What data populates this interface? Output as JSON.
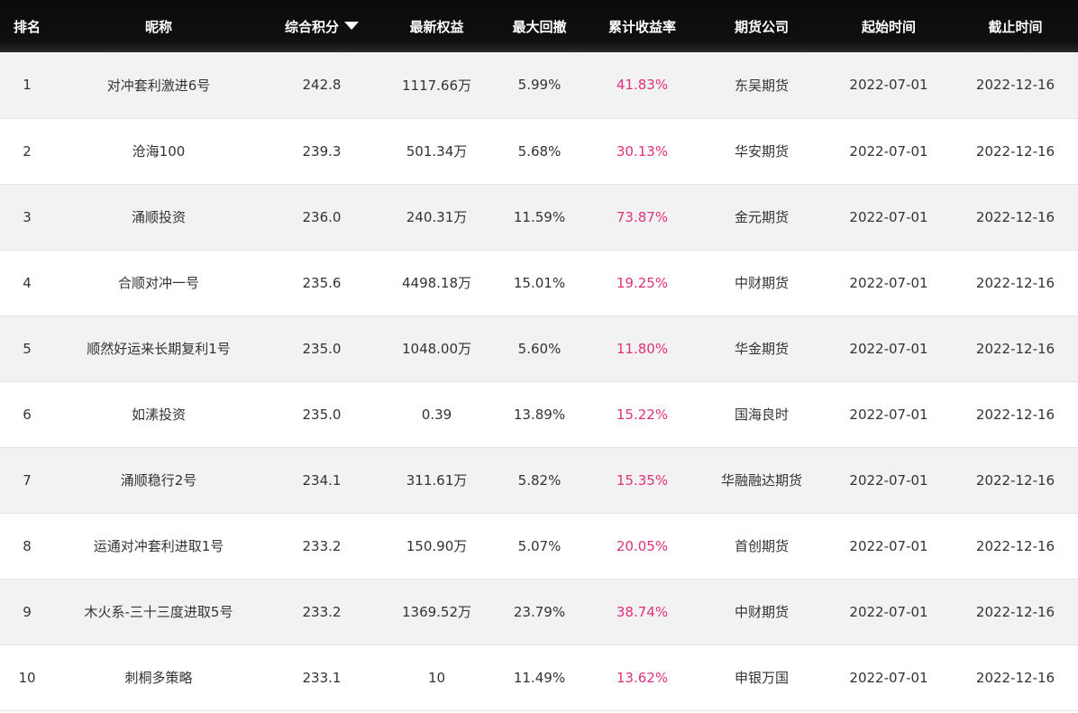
{
  "table": {
    "headers": {
      "rank": "排名",
      "nickname": "昵称",
      "score": "综合积分",
      "equity": "最新权益",
      "drawdown": "最大回撤",
      "return": "累计收益率",
      "company": "期货公司",
      "start": "起始时间",
      "end": "截止时间"
    },
    "sort": {
      "column": "score",
      "direction": "descending",
      "icon": "sort-desc-triangle-icon"
    },
    "rows": [
      {
        "rank": "1",
        "nickname": "对冲套利激进6号",
        "score": "242.8",
        "equity": "1117.66万",
        "drawdown": "5.99%",
        "return": "41.83%",
        "company": "东吴期货",
        "start": "2022-07-01",
        "end": "2022-12-16"
      },
      {
        "rank": "2",
        "nickname": "沧海100",
        "score": "239.3",
        "equity": "501.34万",
        "drawdown": "5.68%",
        "return": "30.13%",
        "company": "华安期货",
        "start": "2022-07-01",
        "end": "2022-12-16"
      },
      {
        "rank": "3",
        "nickname": "涌顺投资",
        "score": "236.0",
        "equity": "240.31万",
        "drawdown": "11.59%",
        "return": "73.87%",
        "company": "金元期货",
        "start": "2022-07-01",
        "end": "2022-12-16"
      },
      {
        "rank": "4",
        "nickname": "合顺对冲一号",
        "score": "235.6",
        "equity": "4498.18万",
        "drawdown": "15.01%",
        "return": "19.25%",
        "company": "中财期货",
        "start": "2022-07-01",
        "end": "2022-12-16"
      },
      {
        "rank": "5",
        "nickname": "顺然好运来长期复利1号",
        "score": "235.0",
        "equity": "1048.00万",
        "drawdown": "5.60%",
        "return": "11.80%",
        "company": "华金期货",
        "start": "2022-07-01",
        "end": "2022-12-16"
      },
      {
        "rank": "6",
        "nickname": "如溸投资",
        "score": "235.0",
        "equity": "0.39",
        "drawdown": "13.89%",
        "return": "15.22%",
        "company": "国海良时",
        "start": "2022-07-01",
        "end": "2022-12-16"
      },
      {
        "rank": "7",
        "nickname": "涌顺稳行2号",
        "score": "234.1",
        "equity": "311.61万",
        "drawdown": "5.82%",
        "return": "15.35%",
        "company": "华融融达期货",
        "start": "2022-07-01",
        "end": "2022-12-16"
      },
      {
        "rank": "8",
        "nickname": "运通对冲套利进取1号",
        "score": "233.2",
        "equity": "150.90万",
        "drawdown": "5.07%",
        "return": "20.05%",
        "company": "首创期货",
        "start": "2022-07-01",
        "end": "2022-12-16"
      },
      {
        "rank": "9",
        "nickname": "木火系-三十三度进取5号",
        "score": "233.2",
        "equity": "1369.52万",
        "drawdown": "23.79%",
        "return": "38.74%",
        "company": "中财期货",
        "start": "2022-07-01",
        "end": "2022-12-16"
      },
      {
        "rank": "10",
        "nickname": "刺桐多策略",
        "score": "233.1",
        "equity": "10",
        "drawdown": "11.49%",
        "return": "13.62%",
        "company": "申银万国",
        "start": "2022-07-01",
        "end": "2022-12-16"
      }
    ]
  },
  "colors": {
    "header_background": "#0b0b0b",
    "header_text": "#ffffff",
    "row_alt_background": "#f2f2f2",
    "return_text": "#e0317a",
    "body_text": "#333333"
  }
}
